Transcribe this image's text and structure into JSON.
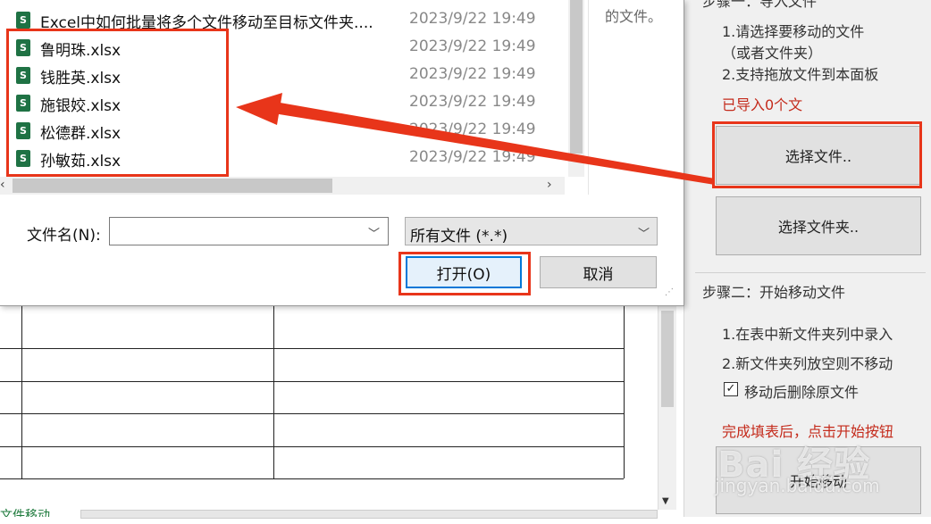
{
  "dialog": {
    "files": [
      {
        "name": "Excel中如何批量将多个文件移动至目标文件夹....",
        "date": "2023/9/22 19:49",
        "icon": "excel-file-icon"
      },
      {
        "name": "鲁明珠.xlsx",
        "date": "2023/9/22 19:49",
        "icon": "excel-file-icon"
      },
      {
        "name": "钱胜英.xlsx",
        "date": "2023/9/22 19:49",
        "icon": "excel-file-icon"
      },
      {
        "name": "施银姣.xlsx",
        "date": "2023/9/22 19:49",
        "icon": "excel-file-icon"
      },
      {
        "name": "松德群.xlsx",
        "date": "2023/9/22 19:49",
        "icon": "excel-file-icon"
      },
      {
        "name": "孙敏茹.xlsx",
        "date": "2023/9/22 19:49",
        "icon": "excel-file-icon"
      }
    ],
    "file_icon_letter": "S",
    "preview_text": "的文件。",
    "filename_label": "文件名(N):",
    "filename_value": "",
    "filetype_value": "所有文件 (*.*)",
    "open_label": "打开(O)",
    "cancel_label": "取消"
  },
  "panel": {
    "step1_title": "步骤一：导入文件",
    "step1_line1": "1.请选择要移动的文件",
    "step1_line2": "（或者文件夹）",
    "step1_line3": "2.支持拖放文件到本面板",
    "imported_status": "已导入0个文",
    "select_files_label": "选择文件..",
    "select_folder_label": "选择文件夹..",
    "step2_title": "步骤二：开始移动文件",
    "step2_line1": "1.在表中新文件夹列中录入",
    "step2_line2": "2.新文件夹列放空则不移动",
    "delete_checkbox_label": "移动后删除原文件",
    "delete_checkbox_checked": true,
    "hint_text": "完成填表后，点击开始按钮",
    "start_move_label": "开始移动"
  },
  "sheet": {
    "tab_label": "文件移动"
  },
  "watermark": {
    "brand": "Bai 经验",
    "url": "jingyan.baidu.com"
  },
  "colors": {
    "annotation_red": "#e8351a",
    "excel_green": "#1f7244",
    "accent_blue": "#0078d7",
    "status_red": "#c42b1c"
  }
}
